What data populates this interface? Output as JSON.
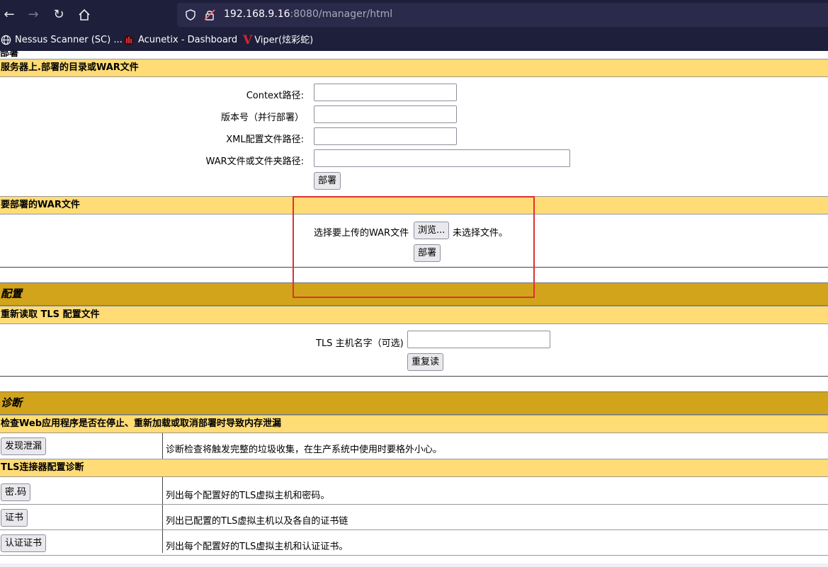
{
  "browser": {
    "url_host": "192.168.9.16",
    "url_rest": ":8080/manager/html",
    "bookmarks": [
      {
        "label": "Nessus Scanner (SC) ...",
        "icon": "globe-icon"
      },
      {
        "label": "Acunetix - Dashboard",
        "icon": "acunetix-icon"
      },
      {
        "label": "Viper(炫彩蛇)",
        "icon": "viper-icon"
      }
    ]
  },
  "deploy": {
    "top_cut_label": "部署",
    "server_section": {
      "title": "服务器上.部署的目录或WAR文件",
      "context_label": "Context路径:",
      "version_label": "版本号（并行部署）",
      "xml_label": "XML配置文件路径:",
      "war_label": "WAR文件或文件夹路径:",
      "deploy_button": "部署"
    },
    "upload_section": {
      "title": "要部署的WAR文件",
      "choose_label": "选择要上传的WAR文件",
      "browse_button": "浏览...",
      "no_file_text": "未选择文件。",
      "deploy_button": "部署"
    }
  },
  "config": {
    "title": "配置",
    "tls_reload": {
      "title": "重新读取 TLS 配置文件",
      "host_label": "TLS 主机名字（可选)",
      "reload_button": "重复读"
    }
  },
  "diagnostics": {
    "title": "诊断",
    "leak": {
      "title": "检查Web应用程序是否在停止、重新加载或取消部署时导致内存泄漏",
      "button": "发现泄漏",
      "description": "诊断检查将触发完整的垃圾收集，在生产系统中使用时要格外小心。"
    },
    "tls_connector": {
      "title": "TLS连接器配置诊断",
      "rows": [
        {
          "button": "密.码",
          "description": "列出每个配置好的TLS虚拟主机和密码。"
        },
        {
          "button": "证书",
          "description": "列出已配置的TLS虚拟主机以及各自的证书链"
        },
        {
          "button": "认证证书",
          "description": "列出每个配置好的TLS虚拟主机和认证证书。"
        }
      ]
    }
  },
  "colors": {
    "chrome_bg": "#1e1f3b",
    "subheader_bg": "#ffdc75",
    "section_bg": "#d2a41c",
    "highlight_border": "#e03030"
  }
}
